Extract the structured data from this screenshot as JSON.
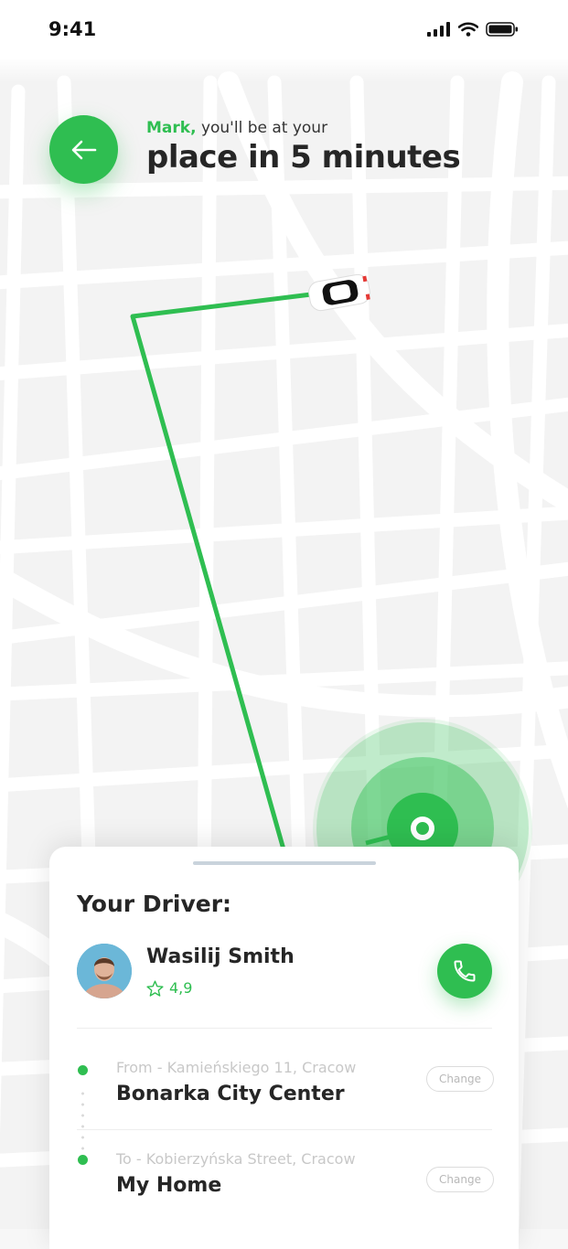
{
  "status_bar": {
    "time": "9:41"
  },
  "header": {
    "name": "Mark,",
    "line1_rest": " you'll be at your",
    "line2": "place in 5 minutes"
  },
  "driver_card": {
    "title": "Your Driver:",
    "driver_name": "Wasilij Smith",
    "rating": "4,9"
  },
  "route": {
    "from": {
      "address": "From - Kamieńskiego 11, Cracow",
      "place": "Bonarka City Center",
      "change_label": "Change"
    },
    "to": {
      "address": "To - Kobierzyńska Street, Cracow",
      "place": "My Home",
      "change_label": "Change"
    }
  },
  "colors": {
    "accent": "#2fbe51",
    "text_dark": "#262626",
    "text_muted": "#c8c8c8",
    "map_background": "#f3f3f3",
    "map_roads": "#ffffff"
  },
  "icons": {
    "back": "arrow-left-icon",
    "car": "car-icon",
    "destination": "location-pin-icon",
    "rating": "star-icon",
    "call": "phone-icon"
  }
}
